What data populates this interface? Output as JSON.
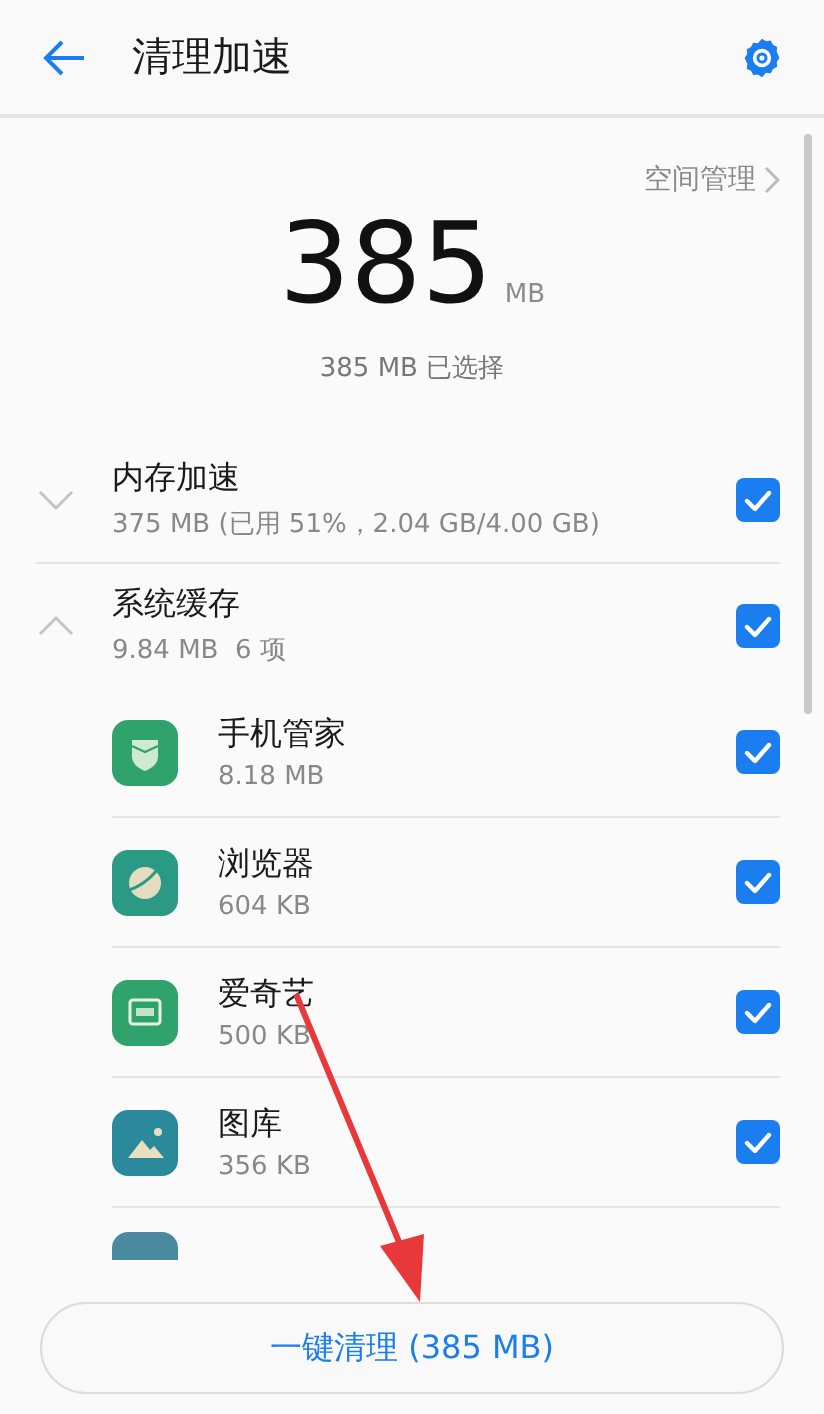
{
  "header": {
    "title": "清理加速"
  },
  "space_link": {
    "label": "空间管理"
  },
  "summary": {
    "amount": "385",
    "unit": "MB",
    "selected_text": "385 MB 已选择"
  },
  "groups": [
    {
      "title": "内存加速",
      "subtitle": "375 MB (已用 51%，2.04 GB/4.00 GB)",
      "expanded": false,
      "checked": true
    },
    {
      "title": "系统缓存",
      "subtitle": "9.84 MB  6 项",
      "expanded": true,
      "checked": true,
      "children": [
        {
          "name": "手机管家",
          "size": "8.18 MB",
          "kind": "shield",
          "color": "#2fa36b",
          "checked": true
        },
        {
          "name": "浏览器",
          "size": "604 KB",
          "kind": "planet",
          "color": "#2b9a84",
          "checked": true
        },
        {
          "name": "爱奇艺",
          "size": "500 KB",
          "kind": "tv",
          "color": "#2fa36b",
          "checked": true
        },
        {
          "name": "图库",
          "size": "356 KB",
          "kind": "gallery",
          "color": "#2a8a9c",
          "checked": true
        }
      ]
    }
  ],
  "clean_button": {
    "label": "一键清理 (385 MB)"
  }
}
